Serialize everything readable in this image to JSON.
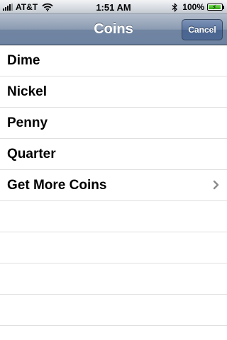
{
  "status_bar": {
    "carrier": "AT&T",
    "time": "1:51 AM",
    "battery_percent": "100%",
    "battery_level": 1.0
  },
  "nav_bar": {
    "title": "Coins",
    "cancel_label": "Cancel"
  },
  "list": {
    "items": [
      {
        "label": "Dime"
      },
      {
        "label": "Nickel"
      },
      {
        "label": "Penny"
      },
      {
        "label": "Quarter"
      },
      {
        "label": "Get More Coins",
        "disclosure": "chevron-right-icon"
      }
    ]
  },
  "colors": {
    "nav_bar": "#7185a2",
    "cancel_button": "#4a6590",
    "separator": "#e0e0e0"
  }
}
